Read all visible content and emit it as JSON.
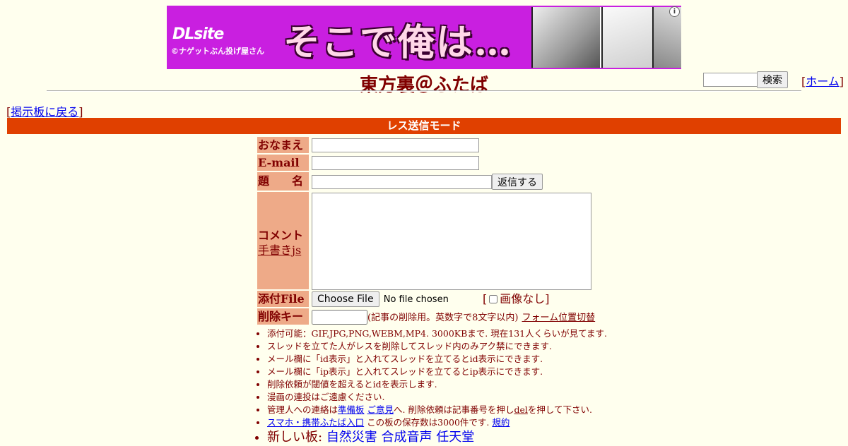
{
  "banner": {
    "logo": "DLsite",
    "copyright": "©ナゲットぶん投げ屋さん",
    "headline": "そこで俺は…",
    "info_icon": "info-icon"
  },
  "header": {
    "title": "東方裏＠ふたば",
    "search_button": "検索",
    "home_link": "ホーム"
  },
  "nav": {
    "back_link": "掲示板に戻る"
  },
  "mode_bar": "レス送信モード",
  "form": {
    "name_label": "おなまえ",
    "email_label": "E-mail",
    "subject_label": "題　　名",
    "submit_button": "返信する",
    "comment_label": "コメント",
    "handwrite_link": "手書きjs",
    "file_label": "添付File",
    "file_button": "Choose File",
    "file_status": "No file chosen",
    "no_image_label": "画像なし",
    "delkey_label": "削除キー",
    "delkey_note": "(記事の削除用。英数字で8文字以内)",
    "form_switch_link": "フォーム位置切替"
  },
  "rules": {
    "r1": "添付可能：GIF,JPG,PNG,WEBM,MP4. 3000KBまで. 現在131人くらいが見てます.",
    "r2": "スレッドを立てた人がレスを削除してスレッド内のみアク禁にできます.",
    "r3": "メール欄に「id表示」と入れてスレッドを立てるとid表示にできます.",
    "r4": "メール欄に「ip表示」と入れてスレッドを立てるとip表示にできます.",
    "r5": "削除依頼が閾値を超えるとidを表示します.",
    "r6": "漫画の連投はご遠慮ください.",
    "r7_pre": "管理人への連絡は",
    "r7_link1": "準備板",
    "r7_link2": "ご意見",
    "r7_mid": "へ. 削除依頼は記事番号を押し",
    "r7_link3": "del",
    "r7_post": "を押して下さい.",
    "r8_link1": "スマホ・携帯ふたば入口",
    "r8_mid": "この板の保存数は3000件です.",
    "r8_link2": "規約",
    "r9_pre": "新しい板:",
    "r9_link1": "自然災害",
    "r9_link2": "合成音声",
    "r9_link3": "任天堂"
  }
}
